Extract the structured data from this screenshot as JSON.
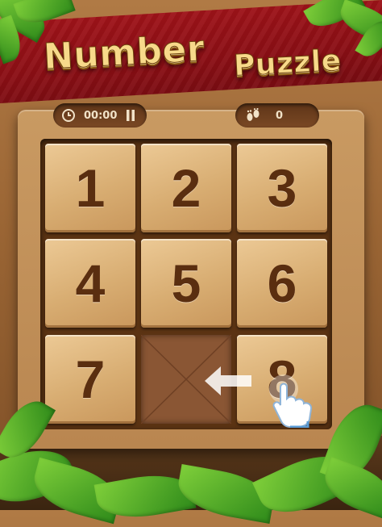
{
  "title": {
    "line1": "Number",
    "line2": "Puzzle"
  },
  "hud": {
    "timer": "00:00",
    "moves": "0"
  },
  "tiles": [
    "1",
    "2",
    "3",
    "4",
    "5",
    "6",
    "7",
    "8"
  ],
  "colors": {
    "banner": "#a9151b",
    "title_gold": "#f7d98a",
    "tile": "#d8ad72",
    "number": "#5a2e10",
    "leaf": "#4caf2a"
  },
  "icons": [
    "clock-icon",
    "pause-icon",
    "footprint-icon",
    "arrow-left-icon",
    "pointer-hand-icon"
  ],
  "empty_position": "row 3, column 2"
}
